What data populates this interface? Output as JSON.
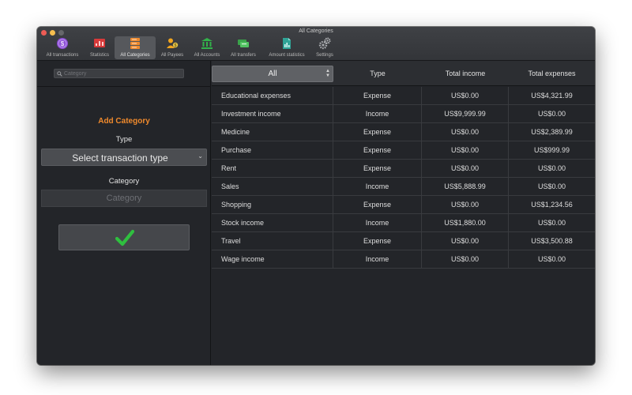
{
  "window": {
    "title": "All Categories"
  },
  "colors": {
    "traffic_close": "#ee5c55",
    "traffic_minimize": "#f6be4f",
    "traffic_maximize": "#66676a",
    "accent": "#f08a2c",
    "checkmark": "#2fbf3f"
  },
  "toolbar": {
    "items": [
      {
        "label": "All transactions",
        "icon": "purple-coin-icon"
      },
      {
        "label": "Statistics",
        "icon": "red-chart-icon"
      },
      {
        "label": "All Categories",
        "icon": "orange-stack-icon",
        "active": true
      },
      {
        "label": "All Payees",
        "icon": "payees-icon"
      },
      {
        "label": "All Accounts",
        "icon": "bank-icon"
      },
      {
        "label": "All transfers",
        "icon": "transfer-icon"
      },
      {
        "label": "Amount statistics",
        "icon": "document-chart-icon"
      },
      {
        "label": "Settings",
        "icon": "gears-icon"
      }
    ]
  },
  "sidebar": {
    "search_placeholder": "Category",
    "add_title": "Add Category",
    "type_label": "Type",
    "type_select_value": "Select transaction type",
    "category_label": "Category",
    "category_placeholder": "Category",
    "confirm_icon": "checkmark-icon"
  },
  "table": {
    "filter_value": "All",
    "columns": [
      "Type",
      "Total income",
      "Total expenses"
    ],
    "rows": [
      {
        "name": "Educational expenses",
        "type": "Expense",
        "income": "US$0.00",
        "expenses": "US$4,321.99"
      },
      {
        "name": "Investment income",
        "type": "Income",
        "income": "US$9,999.99",
        "expenses": "US$0.00"
      },
      {
        "name": "Medicine",
        "type": "Expense",
        "income": "US$0.00",
        "expenses": "US$2,389.99"
      },
      {
        "name": "Purchase",
        "type": "Expense",
        "income": "US$0.00",
        "expenses": "US$999.99"
      },
      {
        "name": "Rent",
        "type": "Expense",
        "income": "US$0.00",
        "expenses": "US$0.00"
      },
      {
        "name": "Sales",
        "type": "Income",
        "income": "US$5,888.99",
        "expenses": "US$0.00"
      },
      {
        "name": "Shopping",
        "type": "Expense",
        "income": "US$0.00",
        "expenses": "US$1,234.56"
      },
      {
        "name": "Stock income",
        "type": "Income",
        "income": "US$1,880.00",
        "expenses": "US$0.00"
      },
      {
        "name": "Travel",
        "type": "Expense",
        "income": "US$0.00",
        "expenses": "US$3,500.88"
      },
      {
        "name": "Wage income",
        "type": "Income",
        "income": "US$0.00",
        "expenses": "US$0.00"
      }
    ]
  }
}
